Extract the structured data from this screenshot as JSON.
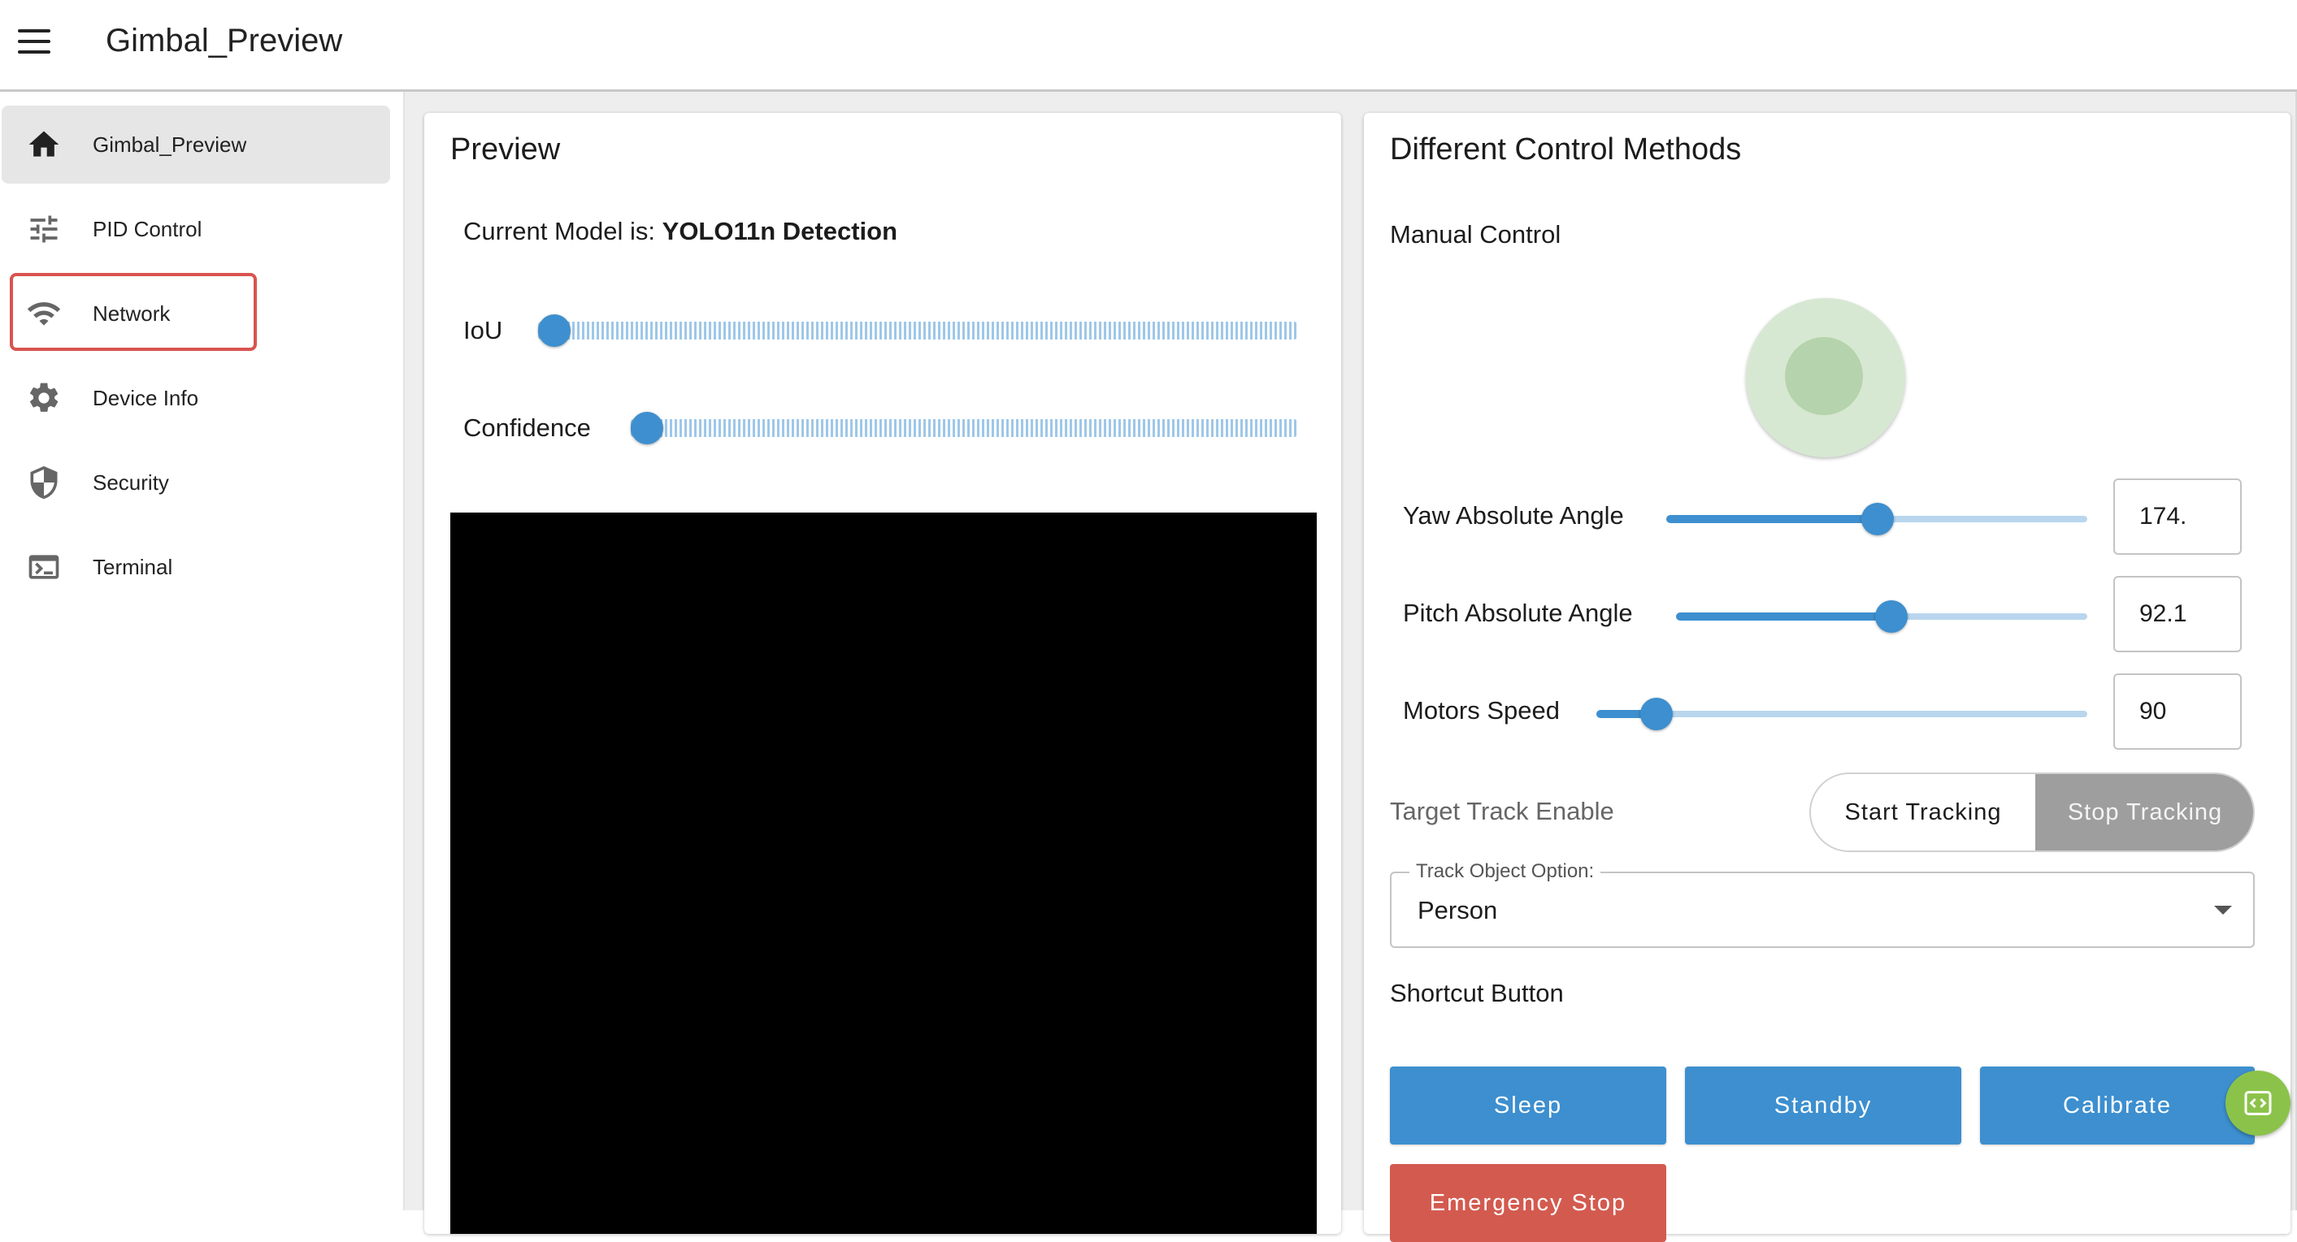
{
  "header": {
    "title": "Gimbal_Preview"
  },
  "sidebar": {
    "items": [
      {
        "label": "Gimbal_Preview",
        "icon": "home-icon",
        "active": true
      },
      {
        "label": "PID Control",
        "icon": "tune-icon",
        "active": false
      },
      {
        "label": "Network",
        "icon": "wifi-icon",
        "active": false
      },
      {
        "label": "Device Info",
        "icon": "gear-icon",
        "active": false
      },
      {
        "label": "Security",
        "icon": "shield-icon",
        "active": false
      },
      {
        "label": "Terminal",
        "icon": "terminal-icon",
        "active": false
      }
    ],
    "highlight_color": "#d9534f"
  },
  "preview": {
    "title": "Preview",
    "model_prefix": "Current Model is: ",
    "model_name": "YOLO11n Detection",
    "iou_label": "IoU",
    "confidence_label": "Confidence",
    "iou_value_fraction": 0.0,
    "confidence_value_fraction": 0.0
  },
  "control": {
    "title": "Different Control Methods",
    "manual_label": "Manual Control",
    "yaw": {
      "label": "Yaw Absolute Angle",
      "value": "174.",
      "fraction": 0.5
    },
    "pitch": {
      "label": "Pitch Absolute Angle",
      "value": "92.1",
      "fraction": 0.52
    },
    "speed": {
      "label": "Motors Speed",
      "value": "90",
      "fraction": 0.12
    },
    "track_enable_label": "Target Track Enable",
    "start_tracking": "Start Tracking",
    "stop_tracking": "Stop Tracking",
    "track_option_legend": "Track Object Option:",
    "track_option_value": "Person",
    "shortcut_label": "Shortcut Button",
    "buttons": {
      "sleep": "Sleep",
      "standby": "Standby",
      "calibrate": "Calibrate",
      "emergency": "Emergency Stop"
    }
  },
  "colors": {
    "accent": "#3d8fcf",
    "danger": "#d35a4f",
    "toggle_active": "#9e9e9e",
    "joystick": "#d7e8d2",
    "fab": "#8bc34a"
  }
}
